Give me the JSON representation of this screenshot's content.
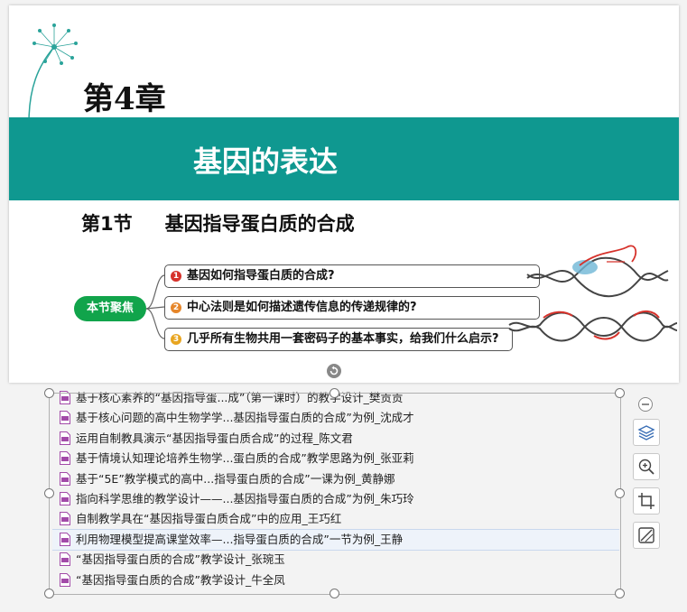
{
  "slide": {
    "chapter": "第4章",
    "title": "基因的表达",
    "section_number": "第1节",
    "section_title": "基因指导蛋白质的合成",
    "focus_label": "本节聚焦",
    "questions": [
      {
        "num": "1",
        "color": "#d6322b",
        "text": "基因如何指导蛋白质的合成?"
      },
      {
        "num": "2",
        "color": "#e6862a",
        "text": "中心法则是如何描述遗传信息的传递规律的?"
      },
      {
        "num": "3",
        "color": "#e8a520",
        "text": "几乎所有生物共用一套密码子的基本事实，给我们什么启示?"
      }
    ],
    "accent": "#0f9890"
  },
  "file_list": [
    "基于核心素养的“基因指导蛋...成”（第一课时）的教学设计_樊贡贡",
    "基于核心问题的高中生物学学...基因指导蛋白质的合成”为例_沈成才",
    "运用自制教具演示“基因指导蛋白质合成”的过程_陈文君",
    "基于情境认知理论培养生物学...蛋白质的合成”教学思路为例_张亚莉",
    "基于“5E”教学模式的高中...指导蛋白质的合成”一课为例_黄静娜",
    "指向科学思维的教学设计——...基因指导蛋白质的合成”为例_朱巧玲",
    "自制教学具在“基因指导蛋白质合成”中的应用_王巧红",
    "利用物理模型提高课堂效率—...指导蛋白质的合成”一节为例_王静",
    "“基因指导蛋白质的合成”教学设计_张琬玉",
    "“基因指导蛋白质的合成”教学设计_牛全凤"
  ],
  "selected_index": 7,
  "toolbar": [
    "minus-icon",
    "layers-icon",
    "zoom-in-icon",
    "crop-icon",
    "edit-icon"
  ]
}
